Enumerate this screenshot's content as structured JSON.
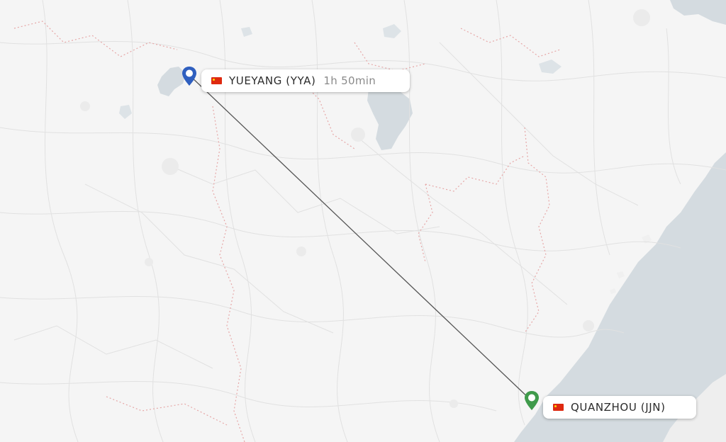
{
  "colors": {
    "land": "#f5f5f5",
    "water": "#d4dbe0",
    "roads": "#e3e3e3",
    "borders": "#e6a7a7",
    "route_line": "#555555",
    "origin_pin": "#2f5fbf",
    "destination_pin": "#3f9a4b",
    "flag_red": "#de2910"
  },
  "origin": {
    "label": "YUEYANG (YYA)",
    "flight_duration": "1h 50min",
    "flag_icon": "china-flag-icon",
    "pin_icon": "map-pin-icon"
  },
  "destination": {
    "label": "QUANZHOU (JJN)",
    "flag_icon": "china-flag-icon",
    "pin_icon": "map-pin-icon"
  }
}
